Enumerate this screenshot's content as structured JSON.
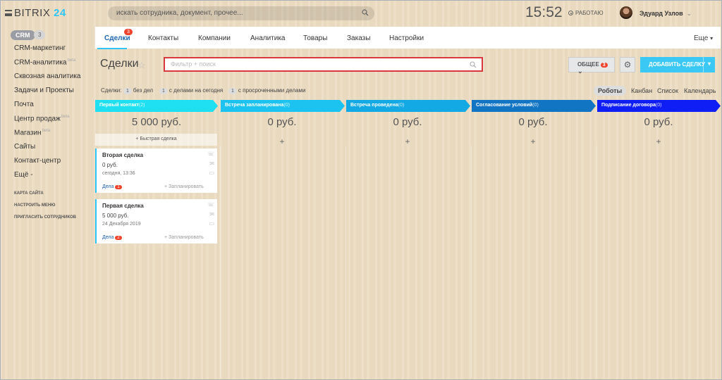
{
  "header": {
    "logo_name": "BITRIX",
    "logo_num": "24",
    "search_placeholder": "искать сотрудника, документ, прочее...",
    "time": "15:52",
    "status": "РАБОТАЮ",
    "user": "Эдуард Узлов"
  },
  "sidebar": {
    "crm_label": "CRM",
    "crm_count": "3",
    "items": [
      {
        "label": "CRM-маркетинг",
        "beta": ""
      },
      {
        "label": "CRM-аналитика",
        "beta": "beta"
      },
      {
        "label": "Сквозная аналитика",
        "beta": ""
      },
      {
        "label": "Задачи и Проекты",
        "beta": ""
      },
      {
        "label": "Почта",
        "beta": ""
      },
      {
        "label": "Центр продаж",
        "beta": "beta"
      },
      {
        "label": "Магазин",
        "beta": "beta"
      },
      {
        "label": "Сайты",
        "beta": ""
      },
      {
        "label": "Контакт-центр",
        "beta": ""
      },
      {
        "label": "Ещё -",
        "beta": ""
      }
    ],
    "links": [
      "КАРТА САЙТА",
      "НАСТРОИТЬ МЕНЮ",
      "ПРИГЛАСИТЬ СОТРУДНИКОВ"
    ]
  },
  "tabs": {
    "items": [
      "Сделки",
      "Контакты",
      "Компании",
      "Аналитика",
      "Товары",
      "Заказы",
      "Настройки"
    ],
    "badge": "3",
    "more": "Еще"
  },
  "toolbar": {
    "title": "Сделки",
    "filter_placeholder": "Фильтр + поиск",
    "common_label": "ОБЩЕЕ",
    "common_badge": "3",
    "add_label": "ДОБАВИТЬ СДЕЛКУ"
  },
  "counters": {
    "prefix": "Сделки:",
    "items": [
      {
        "count": "1",
        "label": "без дел"
      },
      {
        "count": "1",
        "label": "с делами на сегодня"
      },
      {
        "count": "1",
        "label": "с просроченными делами"
      }
    ]
  },
  "views": [
    "Роботы",
    "Канбан",
    "Список",
    "Календарь"
  ],
  "stages": [
    {
      "name": "Первый контакт",
      "count": "(2)",
      "color": "#1ee0f2",
      "sum": "5 000 руб."
    },
    {
      "name": "Встреча запланирована",
      "count": "(0)",
      "color": "#1cc3f0",
      "sum": "0 руб."
    },
    {
      "name": "Встреча проведена",
      "count": "(0)",
      "color": "#13a9e4",
      "sum": "0 руб."
    },
    {
      "name": "Согласование условий",
      "count": "(0)",
      "color": "#1175c4",
      "sum": "0 руб."
    },
    {
      "name": "Подписание договора",
      "count": "(0)",
      "color": "#0f1ef5",
      "sum": "0 руб."
    }
  ],
  "quick_deal": "+ Быстрая сделка",
  "plus": "+",
  "cards": [
    {
      "name": "Вторая сделка",
      "amount": "0 руб.",
      "date": "сегодня, 13:36",
      "deals": "Дела",
      "deals_count": "1",
      "plan": "+ Запланировать"
    },
    {
      "name": "Первая сделка",
      "amount": "5 000 руб.",
      "date": "24 Декабря 2019",
      "deals": "Дела",
      "deals_count": "2",
      "plan": "+ Запланировать"
    }
  ]
}
